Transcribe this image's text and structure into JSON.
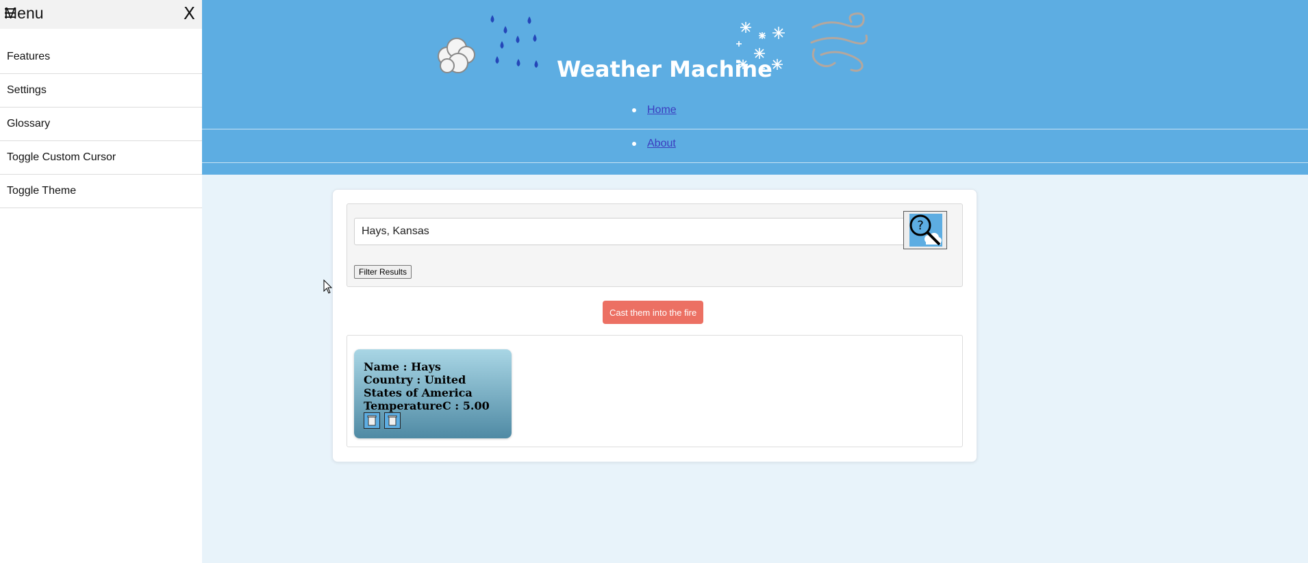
{
  "sidebar": {
    "title": "Menu",
    "close_label": "X",
    "items": [
      {
        "label": "Features"
      },
      {
        "label": "Settings"
      },
      {
        "label": "Glossary"
      },
      {
        "label": "Toggle Custom Cursor"
      },
      {
        "label": "Toggle Theme"
      }
    ]
  },
  "header": {
    "title": "Weather Machine",
    "nav": [
      {
        "label": "Home"
      },
      {
        "label": "About"
      }
    ]
  },
  "search": {
    "value": "Hays, Kansas",
    "filter_label": "Filter Results",
    "search_icon": "magnifier-question-icon"
  },
  "actions": {
    "clear_label": "Cast them into the fire"
  },
  "results": [
    {
      "name_line": "Name : Hays",
      "country_line": "Country : United States of America",
      "temp_line": "TemperatureC : 5.00"
    }
  ],
  "colors": {
    "header_bg": "#5dade2",
    "page_bg": "#e8f3fa",
    "clear_button": "#ec7063",
    "link": "#3b3dbf"
  }
}
